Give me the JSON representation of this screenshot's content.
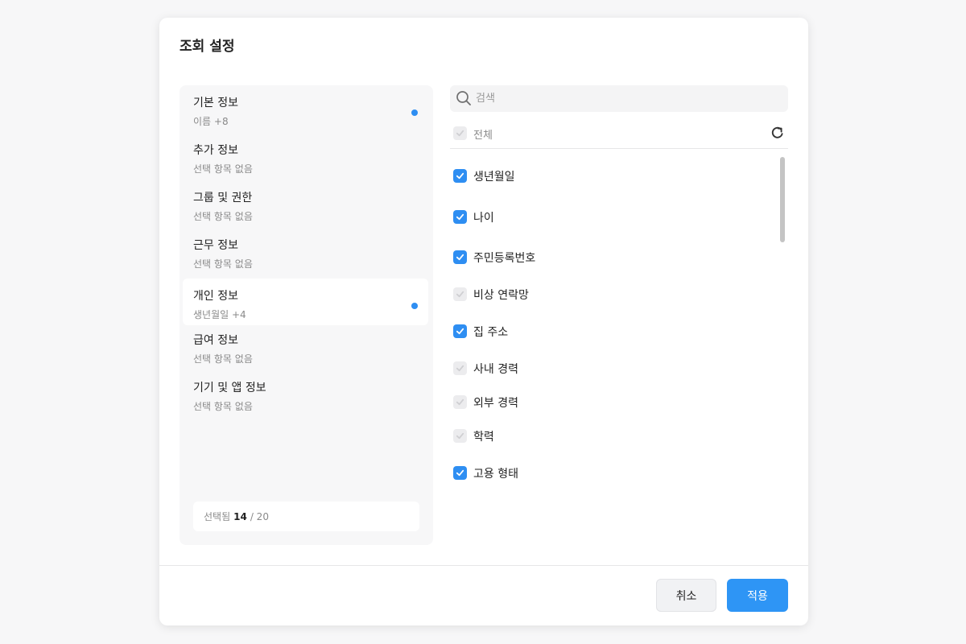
{
  "dialog": {
    "title": "조회 설정"
  },
  "categories": [
    {
      "label": "기본 정보",
      "sub": "이름 +8",
      "dot": true,
      "active": false
    },
    {
      "label": "추가 정보",
      "sub": "선택 항목 없음",
      "dot": false,
      "active": false
    },
    {
      "label": "그룹 및 권한",
      "sub": "선택 항목 없음",
      "dot": false,
      "active": false
    },
    {
      "label": "근무 정보",
      "sub": "선택 항목 없음",
      "dot": false,
      "active": false
    },
    {
      "label": "개인 정보",
      "sub": "생년월일 +4",
      "dot": true,
      "active": true
    },
    {
      "label": "급여 정보",
      "sub": "선택 항목 없음",
      "dot": false,
      "active": false
    },
    {
      "label": "기기 및 앱 정보",
      "sub": "선택 항목 없음",
      "dot": false,
      "active": false
    }
  ],
  "selected_summary": {
    "prefix": "선택됨",
    "count": "14",
    "total": "/ 20"
  },
  "search": {
    "placeholder": "검색",
    "value": ""
  },
  "select_all": {
    "label": "전체",
    "checked": false
  },
  "fields": [
    {
      "label": "생년월일",
      "checked": true
    },
    {
      "label": "나이",
      "checked": true
    },
    {
      "label": "주민등록번호",
      "checked": true
    },
    {
      "label": "비상 연락망",
      "checked": false
    },
    {
      "label": "집 주소",
      "checked": true
    },
    {
      "label": "사내 경력",
      "checked": false
    },
    {
      "label": "외부 경력",
      "checked": false
    },
    {
      "label": "학력",
      "checked": false
    },
    {
      "label": "고용 형태",
      "checked": true
    }
  ],
  "footer": {
    "cancel_label": "취소",
    "apply_label": "적용"
  },
  "colors": {
    "accent": "#2e8ef2",
    "apply_button": "#2e95f5",
    "panel_bg": "#f7f7f8"
  }
}
